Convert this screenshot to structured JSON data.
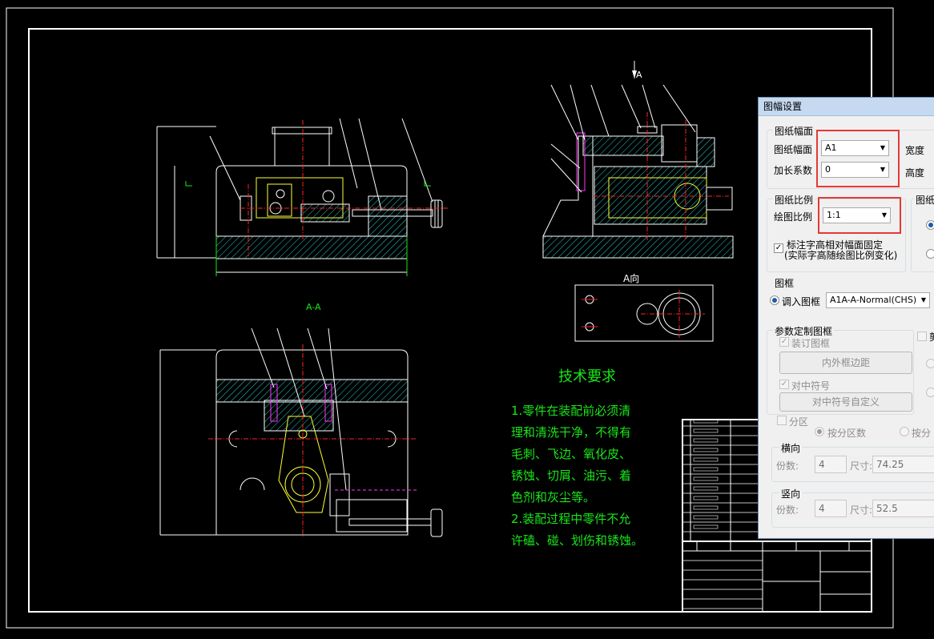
{
  "drawing": {
    "label_section": "A-A",
    "label_view_arrow": "A",
    "label_view": "A向",
    "tech_title": "技术要求",
    "tech_lines": [
      "1.零件在装配前必须清",
      "理和清洗干净，不得有",
      "毛刺、飞边、氧化皮、",
      "锈蚀、切屑、油污、着",
      "色剂和灰尘等。",
      "2.装配过程中零件不允",
      "许磕、碰、划伤和锈蚀。"
    ],
    "colors": {
      "frame": "#ffffff",
      "green": "#19e619",
      "yellow": "#ffff33",
      "cyan": "#33ffff",
      "red": "#ff2020",
      "magenta": "#ff33ff"
    }
  },
  "dialog": {
    "title": "图幅设置",
    "sheet": {
      "group": "图纸幅面",
      "size_label": "图纸幅面",
      "size_value": "A1",
      "ext_label": "加长系数",
      "ext_value": "0",
      "width_label": "宽度",
      "height_label": "高度"
    },
    "scale": {
      "group": "图纸比例",
      "ratio_label": "绘图比例",
      "ratio_value": "1:1",
      "fixed_text_label": "标注字高相对幅面固定",
      "fixed_text_sub": "(实际字高随绘图比例变化)",
      "right_group": "图纸"
    },
    "frame": {
      "group": "图框",
      "load_label": "调入图框",
      "load_value": "A1A-A-Normal(CHS)"
    },
    "custom": {
      "group": "参数定制图框",
      "binding_label": "装订图框",
      "margin_button": "内外框边距",
      "center_label": "对中符号",
      "center_button": "对中符号自定义",
      "zone_label": "分区",
      "by_count_label": "按分区数",
      "by_size_label": "按分",
      "right_check_label": "剪"
    },
    "horizontal": {
      "group": "横向",
      "count_label": "份数:",
      "count_value": "4",
      "size_label": "尺寸:",
      "size_value": "74.25"
    },
    "vertical": {
      "group": "竖向",
      "count_label": "份数:",
      "count_value": "4",
      "size_label": "尺寸:",
      "size_value": "52.5"
    }
  }
}
